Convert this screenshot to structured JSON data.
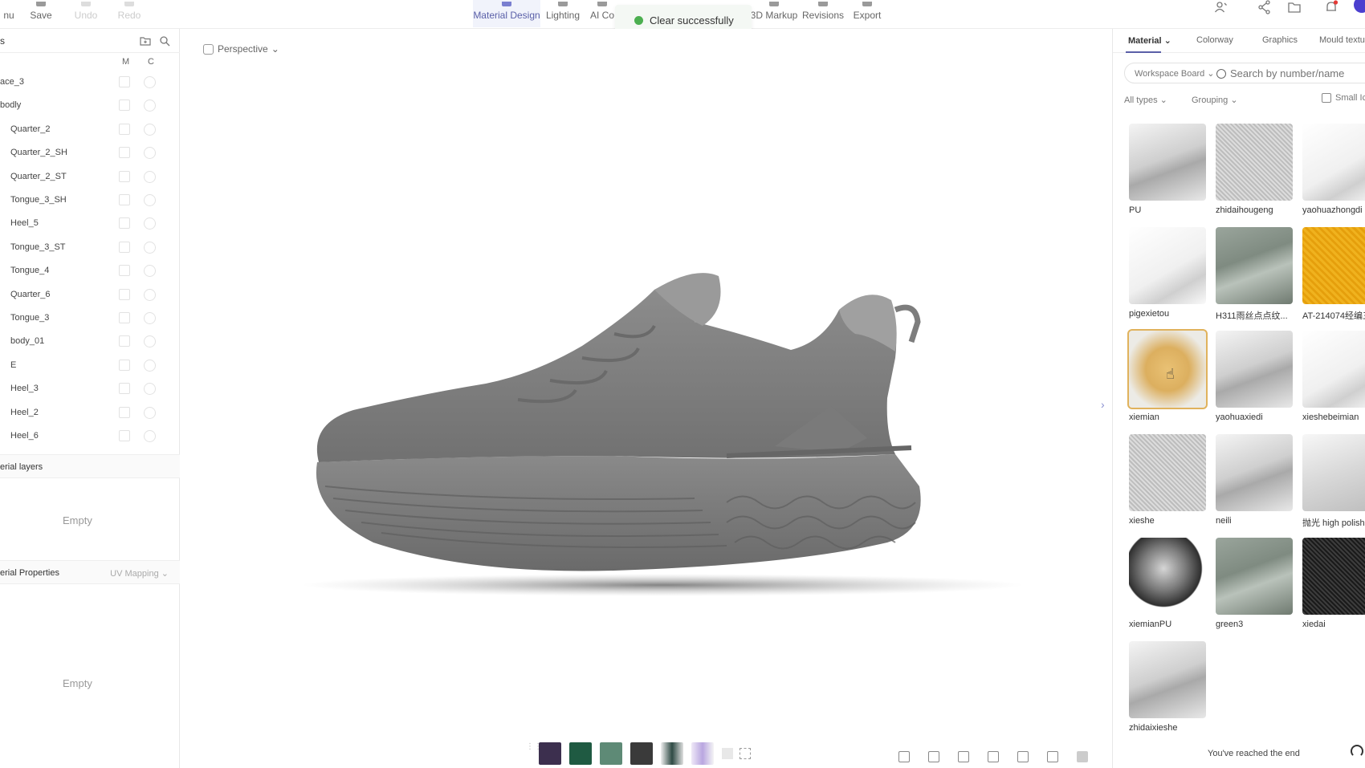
{
  "toolbar": {
    "left": [
      {
        "label": "nu",
        "disabled": false
      },
      {
        "label": "Save",
        "disabled": false
      },
      {
        "label": "Undo",
        "disabled": true
      },
      {
        "label": "Redo",
        "disabled": true
      }
    ],
    "center": [
      {
        "label": "Material Design",
        "active": true
      },
      {
        "label": "Lighting"
      },
      {
        "label": "AI Co"
      },
      {
        "label": "3D Markup"
      },
      {
        "label": "Revisions"
      },
      {
        "label": "Export"
      }
    ],
    "right_icons": [
      "team-icon",
      "share-icon",
      "folder-icon",
      "bell-icon",
      "avatar"
    ]
  },
  "toast": {
    "message": "Clear successfully",
    "status_color": "#4caf50"
  },
  "left_panel": {
    "title": "s",
    "columns": {
      "m": "M",
      "c": "C"
    },
    "layers": [
      "ace_3",
      "bodly",
      "Quarter_2",
      "Quarter_2_SH",
      "Quarter_2_ST",
      "Tongue_3_SH",
      "Heel_5",
      "Tongue_3_ST",
      "Tongue_4",
      "Quarter_6",
      "Tongue_3",
      "body_01",
      "E",
      "Heel_3",
      "Heel_2",
      "Heel_6"
    ],
    "material_layers": {
      "title": "erial layers",
      "empty": "Empty"
    },
    "material_properties": {
      "title": "erial Properties",
      "uv_mapping": "UV Mapping",
      "empty": "Empty"
    }
  },
  "viewport": {
    "view_mode": "Perspective",
    "swatch_colors": [
      "#3c2f4e",
      "#1f5a42",
      "#5e8a76",
      "#3a3a3a"
    ]
  },
  "right_panel": {
    "tabs": [
      "Material",
      "Colorway",
      "Graphics",
      "Mould textu"
    ],
    "search": {
      "scope": "Workspace Board",
      "placeholder": "Search by number/name"
    },
    "filters": {
      "types": "All types",
      "grouping": "Grouping",
      "small_icons": "Small Ic"
    },
    "materials": [
      {
        "name": "PU",
        "style": "silver"
      },
      {
        "name": "zhidaihougeng",
        "style": "mesh"
      },
      {
        "name": "yaohuazhongdi",
        "style": "white"
      },
      {
        "name": "pigexietou",
        "style": "white"
      },
      {
        "name": "H311雨丝点点纹...",
        "style": "sage"
      },
      {
        "name": "AT-214074经编三",
        "style": "yellow"
      },
      {
        "name": "xiemian",
        "style": "selected"
      },
      {
        "name": "yaohuaxiedi",
        "style": "silver"
      },
      {
        "name": "xieshebeimian",
        "style": "white"
      },
      {
        "name": "xieshe",
        "style": "mesh"
      },
      {
        "name": "neili",
        "style": "silver"
      },
      {
        "name": "抛光 high polish",
        "style": "polish"
      },
      {
        "name": "xiemianPU",
        "style": "sphere"
      },
      {
        "name": "green3",
        "style": "sage"
      },
      {
        "name": "xiedai",
        "style": "black"
      },
      {
        "name": "zhidaixieshe",
        "style": "silver"
      }
    ],
    "end_message": "You've reached the end"
  }
}
